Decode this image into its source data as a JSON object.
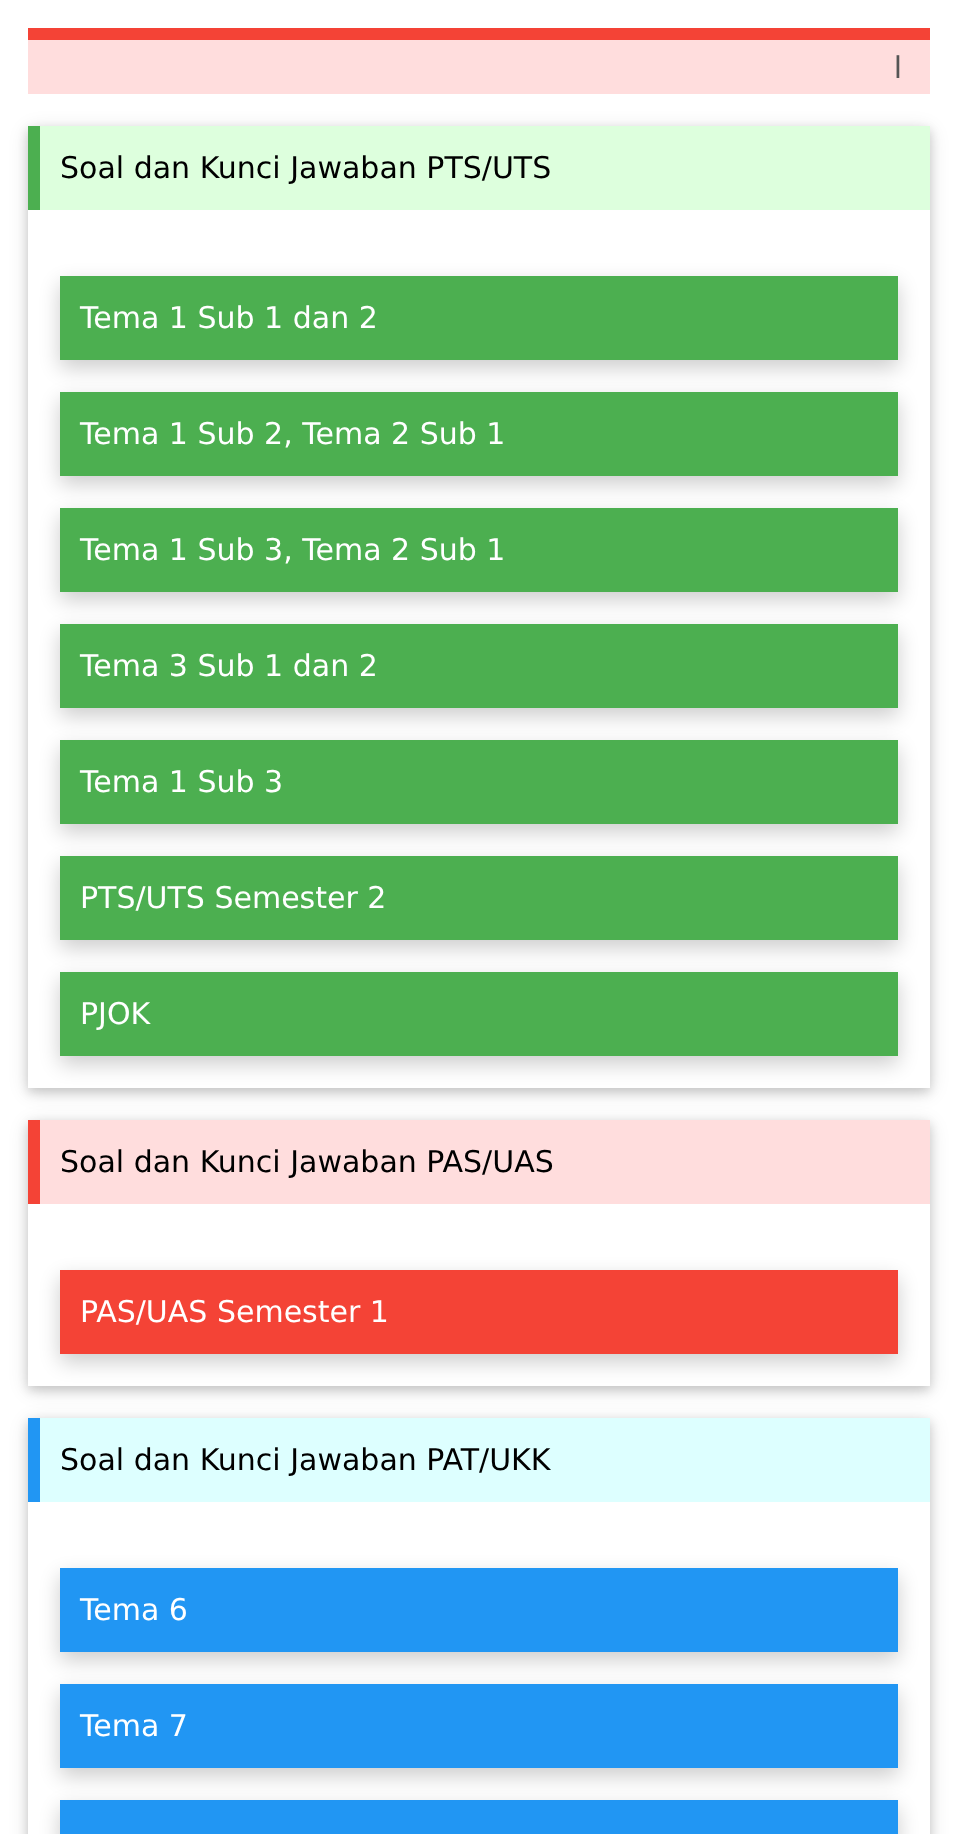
{
  "alert": {
    "text": "l",
    "color": "#f44336"
  },
  "sections": [
    {
      "title": "Soal dan Kunci Jawaban PTS/UTS",
      "color": "#4caf50",
      "buttons": [
        {
          "label": "Tema 1 Sub 1 dan 2"
        },
        {
          "label": "Tema 1 Sub 2, Tema 2 Sub 1"
        },
        {
          "label": "Tema 1 Sub 3, Tema 2 Sub 1"
        },
        {
          "label": "Tema 3 Sub 1 dan 2"
        },
        {
          "label": "Tema 1 Sub 3"
        },
        {
          "label": "PTS/UTS Semester 2"
        },
        {
          "label": "PJOK"
        }
      ]
    },
    {
      "title": "Soal dan Kunci Jawaban PAS/UAS",
      "color": "#f44336",
      "buttons": [
        {
          "label": "PAS/UAS Semester 1"
        }
      ]
    },
    {
      "title": "Soal dan Kunci Jawaban PAT/UKK",
      "color": "#2196f3",
      "buttons": [
        {
          "label": "Tema 6"
        },
        {
          "label": "Tema 7"
        }
      ],
      "cut_off_button": true
    }
  ]
}
